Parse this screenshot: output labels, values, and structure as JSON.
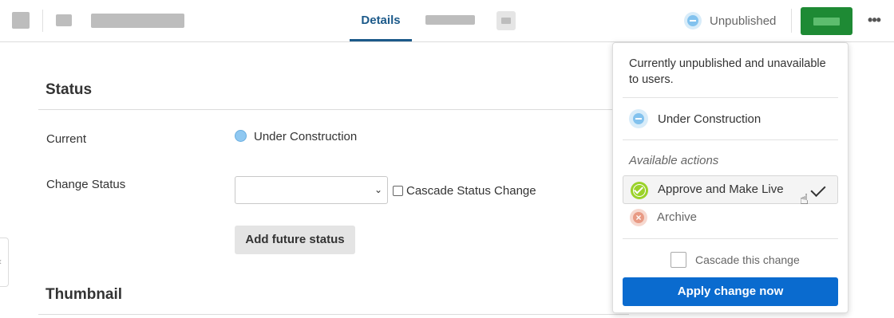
{
  "topbar": {
    "tabs": [
      {
        "label": "Details",
        "active": true
      }
    ],
    "status_label": "Unpublished",
    "more_label": "•••"
  },
  "main": {
    "status_section_title": "Status",
    "current_label": "Current",
    "current_value": "Under Construction",
    "change_status_label": "Change Status",
    "cascade_status_change_label": "Cascade Status Change",
    "add_future_status_label": "Add future status",
    "thumbnail_section_title": "Thumbnail",
    "left_handle_glyph": "‹"
  },
  "panel": {
    "description": "Currently unpublished and unavailable to users.",
    "current_status": "Under Construction",
    "available_actions_title": "Available actions",
    "actions": [
      {
        "label": "Approve and Make Live",
        "selected": true,
        "icon": "approve-check-circle-icon",
        "color": "#9bd22a"
      },
      {
        "label": "Archive",
        "selected": false,
        "icon": "archive-x-circle-icon",
        "color": "#e89a84"
      }
    ],
    "cascade_label": "Cascade this change",
    "apply_label": "Apply change now"
  },
  "colors": {
    "accent_blue": "#0a6bcf",
    "tab_active": "#1c5a8a",
    "publish_green": "#1e8a34",
    "unpublished_blue": "#82c2ee"
  }
}
